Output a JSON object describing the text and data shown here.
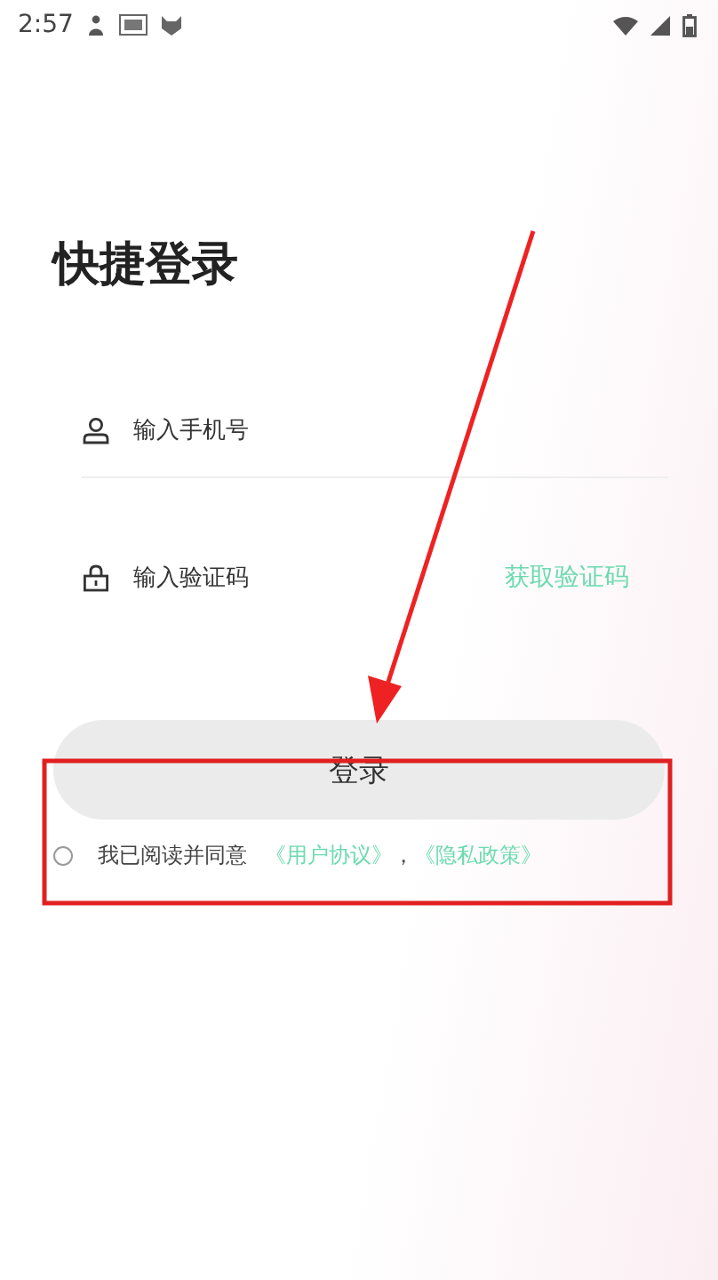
{
  "status_bar": {
    "time": "2:57"
  },
  "title": "快捷登录",
  "fields": [
    {
      "kind": "phone",
      "placeholder": "输入手机号"
    },
    {
      "kind": "code",
      "placeholder": "输入验证码",
      "action": "获取验证码"
    }
  ],
  "login_button": "登录",
  "agreement": {
    "checked": false,
    "text": "我已阅读并同意",
    "links": [
      "《用户协议》",
      "《隐私政策》"
    ],
    "separator": "，"
  }
}
